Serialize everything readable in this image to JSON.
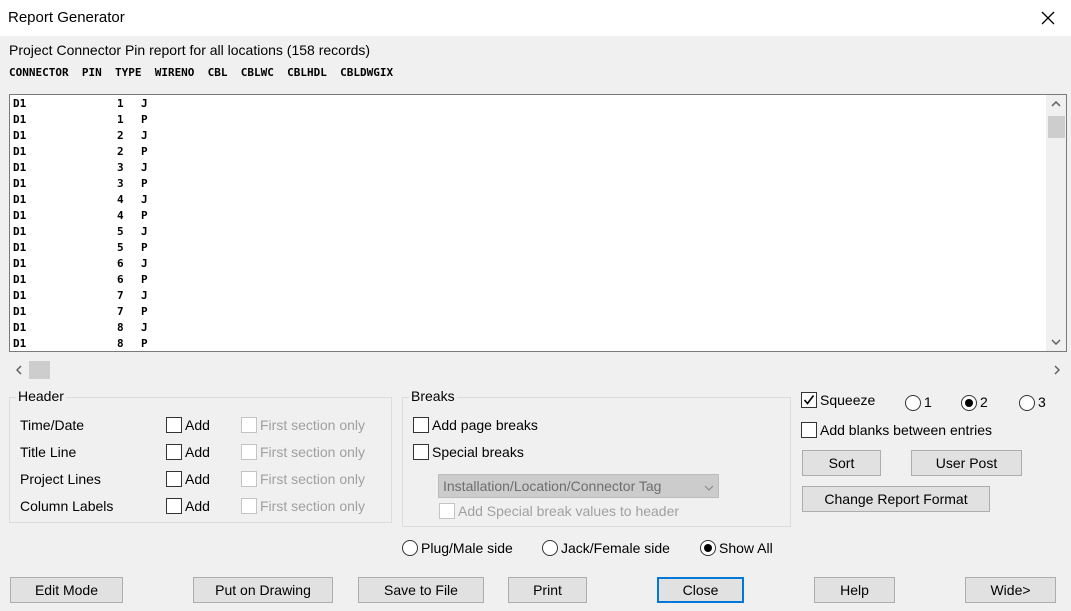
{
  "window": {
    "title": "Report Generator"
  },
  "report": {
    "description": "Project Connector Pin report for all locations (158 records)",
    "columns": "CONNECTOR  PIN  TYPE  WIRENO  CBL  CBLWC  CBLHDL  CBLDWGIX",
    "rows": [
      [
        "D1",
        "1",
        "J"
      ],
      [
        "D1",
        "1",
        "P"
      ],
      [
        "D1",
        "2",
        "J"
      ],
      [
        "D1",
        "2",
        "P"
      ],
      [
        "D1",
        "3",
        "J"
      ],
      [
        "D1",
        "3",
        "P"
      ],
      [
        "D1",
        "4",
        "J"
      ],
      [
        "D1",
        "4",
        "P"
      ],
      [
        "D1",
        "5",
        "J"
      ],
      [
        "D1",
        "5",
        "P"
      ],
      [
        "D1",
        "6",
        "J"
      ],
      [
        "D1",
        "6",
        "P"
      ],
      [
        "D1",
        "7",
        "J"
      ],
      [
        "D1",
        "7",
        "P"
      ],
      [
        "D1",
        "8",
        "J"
      ],
      [
        "D1",
        "8",
        "P"
      ]
    ]
  },
  "header_group": {
    "title": "Header",
    "add_label": "Add",
    "first_only_label": "First section only",
    "items": [
      {
        "label": "Time/Date"
      },
      {
        "label": "Title Line"
      },
      {
        "label": "Project Lines"
      },
      {
        "label": "Column Labels"
      }
    ]
  },
  "breaks_group": {
    "title": "Breaks",
    "add_page_breaks": "Add page breaks",
    "special_breaks": "Special breaks",
    "combo_value": "Installation/Location/Connector Tag",
    "add_special_values": "Add Special break values to header"
  },
  "options": {
    "squeeze": "Squeeze",
    "squeeze_checked": true,
    "radio_1": "1",
    "radio_2": "2",
    "radio_3": "3",
    "selected_squeeze_level": "2",
    "add_blanks": "Add blanks between entries"
  },
  "buttons": {
    "sort": "Sort",
    "user_post": "User Post",
    "change_format": "Change Report Format",
    "edit_mode": "Edit Mode",
    "put_on_drawing": "Put on Drawing",
    "save_to_file": "Save to File",
    "print": "Print",
    "close": "Close",
    "help": "Help",
    "wide": "Wide>"
  },
  "side": {
    "plug": "Plug/Male side",
    "jack": "Jack/Female side",
    "show_all": "Show All",
    "selected": "show_all"
  }
}
